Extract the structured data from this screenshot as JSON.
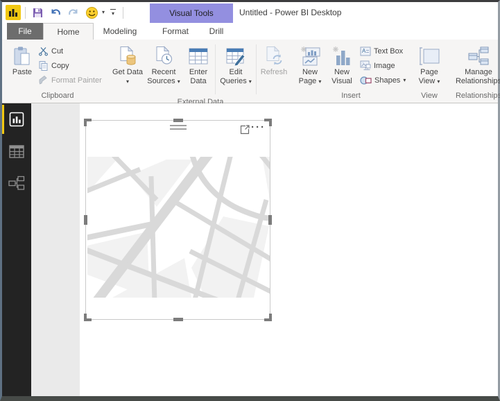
{
  "titlebar": {
    "title": "Untitled - Power BI Desktop",
    "contextual_tab_label": "Visual Tools"
  },
  "tabs": {
    "file": "File",
    "home": "Home",
    "modeling": "Modeling",
    "format": "Format",
    "drill": "Drill"
  },
  "ribbon": {
    "clipboard": {
      "label": "Clipboard",
      "paste": "Paste",
      "cut": "Cut",
      "copy": "Copy",
      "format_painter": "Format Painter"
    },
    "external_data": {
      "label": "External Data",
      "get_data": "Get Data",
      "recent_sources": "Recent Sources",
      "enter_data": "Enter Data",
      "edit_queries": "Edit Queries",
      "refresh": "Refresh"
    },
    "insert": {
      "label": "Insert",
      "new_page": "New Page",
      "new_visual": "New Visual",
      "text_box": "Text Box",
      "image": "Image",
      "shapes": "Shapes"
    },
    "view": {
      "label": "View",
      "page_view": "Page View"
    },
    "relationships": {
      "label": "Relationships",
      "manage_relationships": "Manage Relationships"
    }
  },
  "glyphs": {
    "dropdown_caret": "▾",
    "more_options": "···"
  },
  "colors": {
    "brand_yellow": "#F2C811",
    "contextual_tab_purple": "#938FE0",
    "file_tab_gray": "#6D6D6D",
    "sidebar_dark": "#232323",
    "map_road_gray": "#D9D9D9",
    "map_block_gray": "#F2F2F2"
  }
}
